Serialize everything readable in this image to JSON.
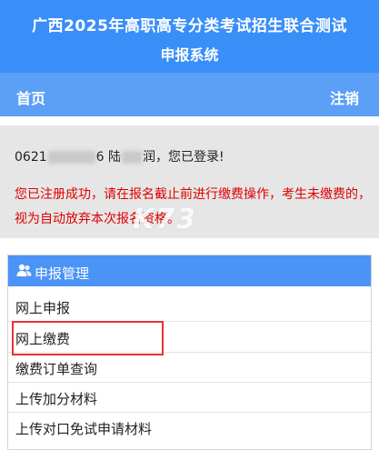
{
  "header": {
    "title_line1": "广西2025年高职高专分类考试招生联合测试",
    "title_line2": "申报系统"
  },
  "nav": {
    "home": "首页",
    "logout": "注销"
  },
  "status": {
    "id_prefix": "0621",
    "id_suffix": "6",
    "name_visible": "陆",
    "name_end": "润",
    "login_message": "，您已登录!",
    "warning": "您已注册成功，请在报名截止前进行缴费操作，考生未缴费的，视为自动放弃本次报名资格。"
  },
  "watermark": "K73",
  "panel": {
    "title": "申报管理",
    "icon": "users-icon",
    "items": [
      {
        "label": "网上申报"
      },
      {
        "label": "网上缴费"
      },
      {
        "label": "缴费订单查询"
      },
      {
        "label": "上传加分材料"
      },
      {
        "label": "上传对口免试申请材料"
      }
    ],
    "highlighted_item": "网上缴费"
  },
  "colors": {
    "header_bg": "#3a8ef8",
    "nav_bg": "#5b9ff7",
    "panel_heading_bg": "#4b93f6",
    "warning_text": "#e00000",
    "highlight_border": "#e53333"
  }
}
